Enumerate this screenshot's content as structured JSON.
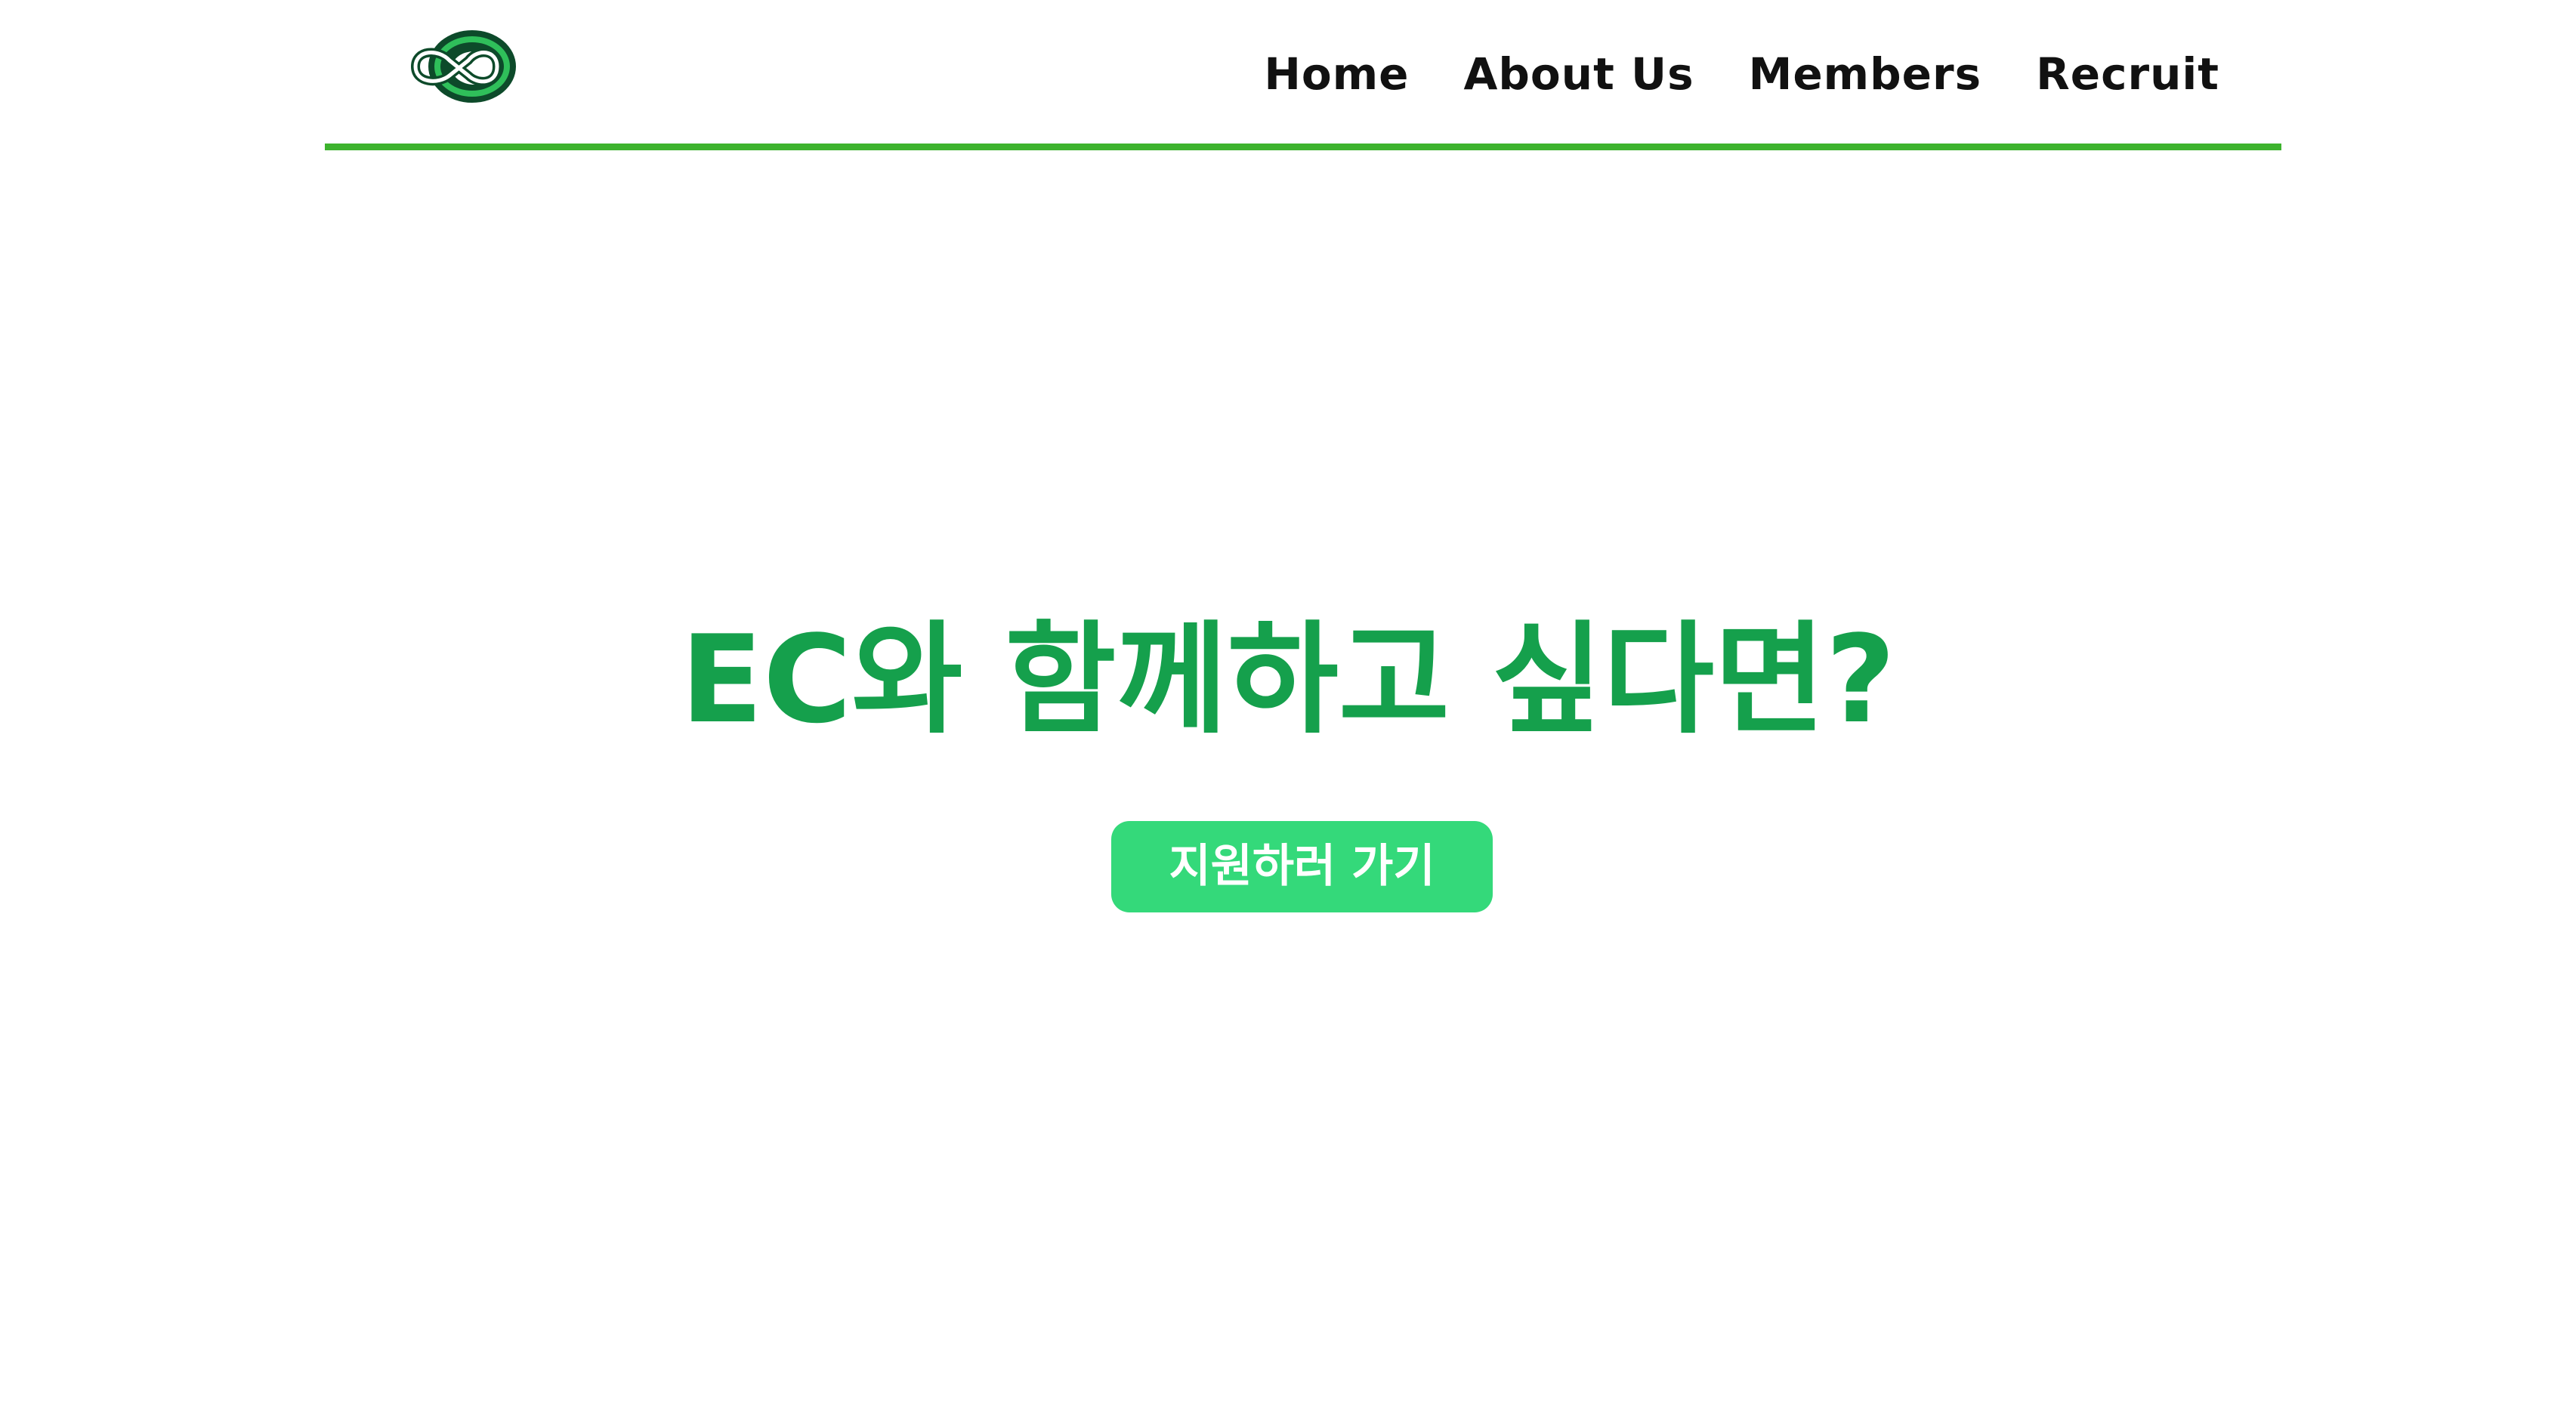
{
  "colors": {
    "accent_green": "#3db32e",
    "title_green": "#15a04c",
    "button_green": "#34d97a",
    "nav_text": "#111111",
    "logo_dark": "#0d4a2a"
  },
  "header": {
    "logo": {
      "icon": "infinity-logo-icon"
    },
    "nav": [
      {
        "label": "Home"
      },
      {
        "label": "About Us"
      },
      {
        "label": "Members"
      },
      {
        "label": "Recruit"
      }
    ]
  },
  "hero": {
    "title": "EC와 함께하고 싶다면?",
    "cta_label": "지원하러 가기"
  }
}
